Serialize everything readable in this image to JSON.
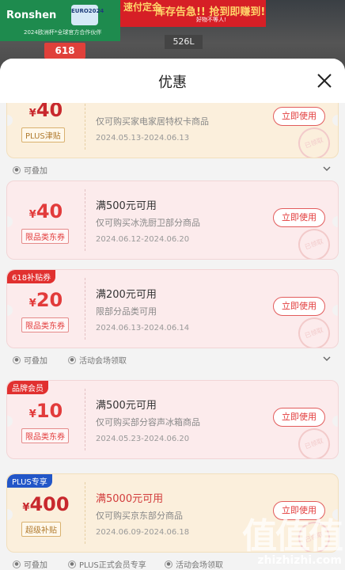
{
  "background": {
    "brand": "Ronshen",
    "euro_badge": "EURO2024",
    "brand_sub": "2024欧洲杯*全球官方合作伙伴",
    "promo_left": "速付定金",
    "promo_right": "库存告急!! 抢到即赚到!",
    "promo_bottom": "好物不等人!",
    "tag_618": "618",
    "tag_526": "526L"
  },
  "sheet": {
    "title": "优惠",
    "close_icon": "close-icon"
  },
  "coupons": [
    {
      "amount": "40",
      "currency": "¥",
      "kind": "PLUS津贴",
      "kind_style": "gold",
      "title": "",
      "desc": "仅可购买家电家居特权卡商品",
      "date": "2024.05.13-2024.06.13",
      "button": "立即使用",
      "stamp": "已领取",
      "style": "gold",
      "footer": [
        {
          "icon": "stack-icon",
          "text": "可叠加"
        }
      ],
      "chevron": true
    },
    {
      "amount": "40",
      "currency": "¥",
      "kind": "限品类东券",
      "kind_style": "red",
      "title": "满500元可用",
      "desc": "仅可购买冰洗厨卫部分商品",
      "date": "2024.06.12-2024.06.20",
      "button": "立即使用",
      "stamp": "已领取",
      "style": "pink",
      "footer": []
    },
    {
      "badge": "618补贴券",
      "badge_style": "red",
      "amount": "20",
      "currency": "¥",
      "kind": "限品类东券",
      "kind_style": "red",
      "title": "满200元可用",
      "desc": "限部分品类可用",
      "date": "2024.06.13-2024.06.14",
      "button": "立即使用",
      "stamp": "已领取",
      "style": "pink",
      "footer": [
        {
          "icon": "stack-icon",
          "text": "可叠加"
        },
        {
          "icon": "venue-icon",
          "text": "活动会场领取"
        }
      ],
      "chevron": true
    },
    {
      "badge": "品牌会员",
      "badge_style": "red",
      "amount": "10",
      "currency": "¥",
      "kind": "限品类东券",
      "kind_style": "red",
      "title": "满500元可用",
      "desc": "仅可购买部分容声冰箱商品",
      "date": "2024.05.23-2024.06.20",
      "button": "立即使用",
      "stamp": "已领取",
      "style": "pink",
      "footer": []
    },
    {
      "badge": "PLUS专享",
      "badge_style": "blue",
      "amount": "400",
      "currency": "¥",
      "kind": "超级补贴",
      "kind_style": "gold",
      "title": "满5000元可用",
      "desc": "仅可购买京东部分商品",
      "date": "2024.06.09-2024.06.18",
      "button": "立即使用",
      "stamp": "已领取",
      "style": "gold",
      "title_red": true,
      "footer": [
        {
          "icon": "stack-icon",
          "text": "可叠加"
        },
        {
          "icon": "plus-icon",
          "text": "PLUS正式会员专享"
        },
        {
          "icon": "venue-icon",
          "text": "活动会场领取"
        }
      ]
    }
  ],
  "watermark": {
    "big": "值值值",
    "small": "zhizhizhi.com"
  }
}
